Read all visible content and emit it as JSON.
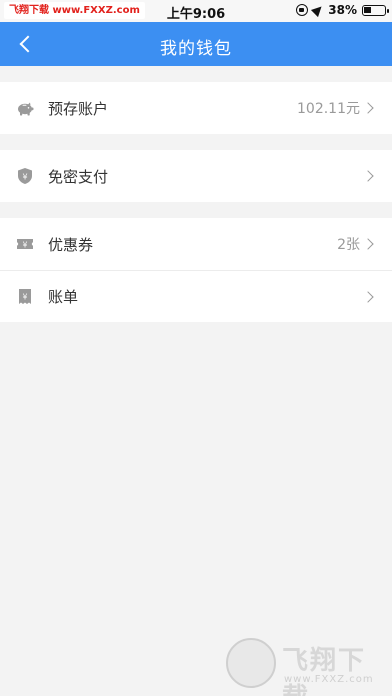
{
  "status_bar": {
    "watermark": "飞翔下载 www.FXXZ.com",
    "time": "上午9:06",
    "battery": "38%"
  },
  "header": {
    "title": "我的钱包"
  },
  "groups": [
    {
      "items": [
        {
          "label": "预存账户",
          "value": "102.11元",
          "icon": "piggy-bank-icon"
        }
      ]
    },
    {
      "items": [
        {
          "label": "免密支付",
          "value": "",
          "icon": "shield-yen-icon"
        }
      ]
    },
    {
      "items": [
        {
          "label": "优惠券",
          "value": "2张",
          "icon": "coupon-icon"
        },
        {
          "label": "账单",
          "value": "",
          "icon": "bill-icon"
        }
      ]
    }
  ],
  "footer_watermark": {
    "brand": "飞翔下载",
    "site": "www.FXXZ.com"
  },
  "colors": {
    "nav_bar": "#3c8ff2",
    "background": "#f3f3f3",
    "icon": "#9a9a9a"
  }
}
